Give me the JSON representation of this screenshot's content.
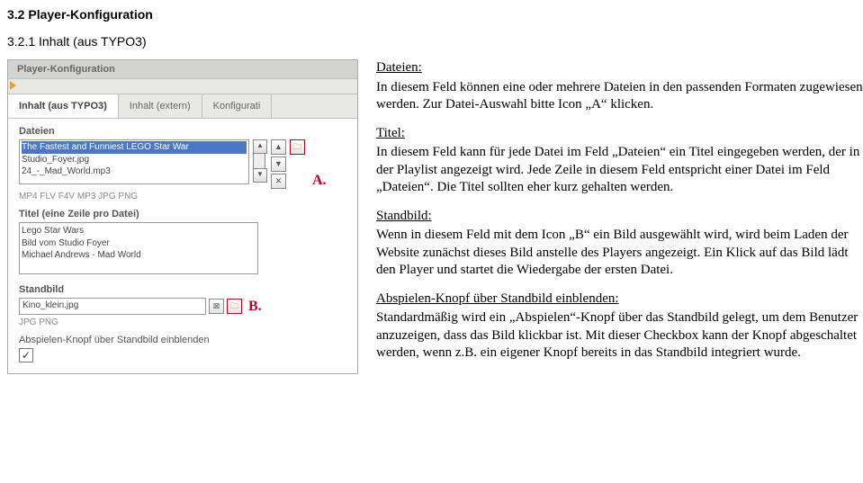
{
  "doc": {
    "h2": "3.2 Player-Konfiguration",
    "h3": "3.2.1 Inhalt (aus TYPO3)"
  },
  "panel": {
    "title": "Player-Konfiguration",
    "tabs": [
      "Inhalt (aus TYPO3)",
      "Inhalt (extern)",
      "Konfigurati"
    ],
    "dateien_label": "Dateien",
    "dateien_items": [
      "The Fastest and Funniest LEGO Star War",
      "Studio_Foyer.jpg",
      "24_-_Mad_World.mp3"
    ],
    "dateien_hint": "MP4 FLV F4V MP3 JPG PNG",
    "titel_label": "Titel (eine Zeile pro Datei)",
    "titel_lines": "Lego Star Wars\nBild vom Studio Foyer\nMichael Andrews - Mad World",
    "standbild_label": "Standbild",
    "standbild_value": "Kino_klein.jpg",
    "standbild_hint": "JPG PNG",
    "abspielen_label": "Abspielen-Knopf über Standbild einblenden",
    "checkbox_checked": "✓"
  },
  "callouts": {
    "a": "A.",
    "b": "B."
  },
  "text": {
    "dateien_h": "Dateien:",
    "dateien_p": "In diesem Feld können eine oder mehrere Dateien in den passenden Formaten zugewiesen werden. Zur Datei-Auswahl bitte Icon „A“ klicken.",
    "titel_h": "Titel:",
    "titel_p": "In diesem Feld kann für jede Datei im Feld „Dateien“ ein Titel eingegeben werden, der in der Playlist angezeigt wird. Jede Zeile in diesem Feld entspricht einer Datei im Feld „Dateien“. Die Titel sollten eher kurz gehalten werden.",
    "standbild_h": "Standbild:",
    "standbild_p": "Wenn in diesem Feld mit dem Icon „B“ ein Bild ausgewählt wird, wird beim Laden der Website zunächst dieses Bild anstelle des Players angezeigt. Ein Klick auf das Bild lädt den Player und startet die Wiedergabe der ersten Datei.",
    "abspielen_h": "Abspielen-Knopf über Standbild einblenden:",
    "abspielen_p": "Standardmäßig wird ein „Abspielen“-Knopf über das Standbild gelegt, um dem Benutzer anzuzeigen, dass das Bild klickbar ist. Mit dieser Checkbox kann der Knopf abgeschaltet werden, wenn z.B. ein eigener Knopf bereits in das Standbild integriert wurde."
  }
}
